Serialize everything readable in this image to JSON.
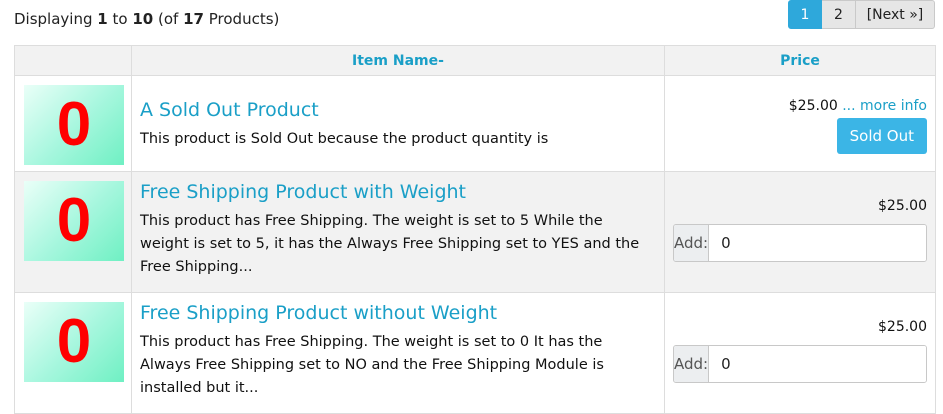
{
  "listing": {
    "displaying_prefix": "Displaying",
    "from": "1",
    "to_word": "to",
    "to": "10",
    "of_prefix": "(of",
    "total": "17",
    "products_suffix": "Products)"
  },
  "pagination": {
    "current_page": "1",
    "page_2": "2",
    "next_label": "[Next »]"
  },
  "table": {
    "headers": {
      "item_name": "Item Name-",
      "price": "Price"
    },
    "products": [
      {
        "image_text": "0",
        "name": "A Sold Out Product",
        "description": "This product is Sold Out because the product quantity is",
        "price": "$25.00",
        "more_info": "... more info",
        "button_label": "Sold Out"
      },
      {
        "image_text": "0",
        "name": "Free Shipping Product with Weight",
        "description": "This product has Free Shipping. The weight is set to 5 While the weight is set to 5, it has the Always Free Shipping set to YES and the Free Shipping...",
        "price": "$25.00",
        "add_label": "Add:",
        "add_value": "0"
      },
      {
        "image_text": "0",
        "name": "Free Shipping Product without Weight",
        "description": "This product has Free Shipping. The weight is set to 0 It has the Always Free Shipping set to NO and the Free Shipping Module is installed but it...",
        "price": "$25.00",
        "add_label": "Add:",
        "add_value": "0"
      }
    ]
  },
  "colors": {
    "accent": "#1a9fc7",
    "button": "#3bb5e6",
    "active_page": "#2ea8db",
    "image_zero": "#ff0000"
  }
}
